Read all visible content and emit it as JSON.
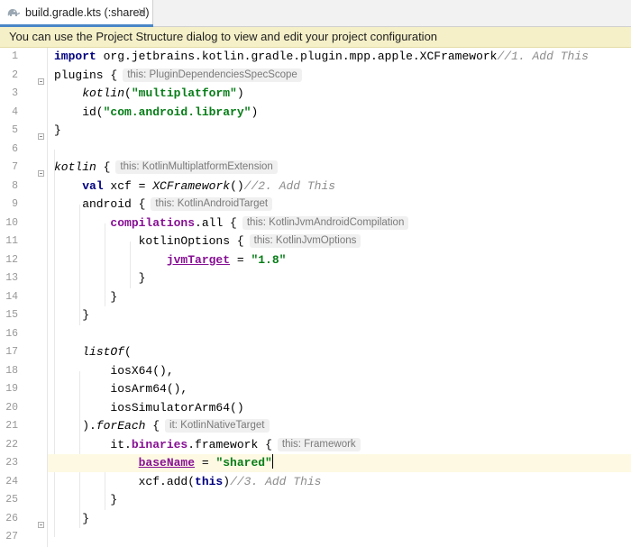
{
  "tab": {
    "title": "build.gradle.kts (:shared)",
    "close": "✕"
  },
  "notice": {
    "text": "You can use the Project Structure dialog to view and edit your project configuration"
  },
  "lines": [
    {
      "n": "1",
      "tokens": [
        {
          "t": "import",
          "c": "kw"
        },
        {
          "t": " org.jetbrains.kotlin.gradle.plugin.mpp.apple.XCFramework"
        },
        {
          "t": "//1. Add This",
          "c": "cmt"
        }
      ]
    },
    {
      "n": "2",
      "tokens": [
        {
          "t": "plugins {"
        }
      ],
      "hint": "this: PluginDependenciesSpecScope"
    },
    {
      "n": "3",
      "tokens": [
        {
          "t": "    "
        },
        {
          "t": "kotlin",
          "c": "ital"
        },
        {
          "t": "("
        },
        {
          "t": "\"multiplatform\"",
          "c": "str"
        },
        {
          "t": ")"
        }
      ]
    },
    {
      "n": "4",
      "tokens": [
        {
          "t": "    id("
        },
        {
          "t": "\"com.android.library\"",
          "c": "str"
        },
        {
          "t": ")"
        }
      ]
    },
    {
      "n": "5",
      "tokens": [
        {
          "t": "}"
        }
      ]
    },
    {
      "n": "6",
      "tokens": []
    },
    {
      "n": "7",
      "tokens": [
        {
          "t": "kotlin",
          "c": "ital"
        },
        {
          "t": " {"
        }
      ],
      "hint": "this: KotlinMultiplatformExtension"
    },
    {
      "n": "8",
      "tokens": [
        {
          "t": "    "
        },
        {
          "t": "val",
          "c": "kw"
        },
        {
          "t": " xcf = "
        },
        {
          "t": "XCFramework",
          "c": "ital"
        },
        {
          "t": "()"
        },
        {
          "t": "//2. Add This",
          "c": "cmt"
        }
      ]
    },
    {
      "n": "9",
      "tokens": [
        {
          "t": "    android {"
        }
      ],
      "hint": "this: KotlinAndroidTarget"
    },
    {
      "n": "10",
      "tokens": [
        {
          "t": "        "
        },
        {
          "t": "compilations",
          "c": "prop"
        },
        {
          "t": ".all {"
        }
      ],
      "hint": "this: KotlinJvmAndroidCompilation"
    },
    {
      "n": "11",
      "tokens": [
        {
          "t": "            kotlinOptions {"
        }
      ],
      "hint": "this: KotlinJvmOptions"
    },
    {
      "n": "12",
      "tokens": [
        {
          "t": "                "
        },
        {
          "t": "jvmTarget",
          "c": "prop ul"
        },
        {
          "t": " = "
        },
        {
          "t": "\"1.8\"",
          "c": "str"
        }
      ]
    },
    {
      "n": "13",
      "tokens": [
        {
          "t": "            }"
        }
      ]
    },
    {
      "n": "14",
      "tokens": [
        {
          "t": "        }"
        }
      ]
    },
    {
      "n": "15",
      "tokens": [
        {
          "t": "    }"
        }
      ]
    },
    {
      "n": "16",
      "tokens": []
    },
    {
      "n": "17",
      "tokens": [
        {
          "t": "    "
        },
        {
          "t": "listOf",
          "c": "ital"
        },
        {
          "t": "("
        }
      ]
    },
    {
      "n": "18",
      "tokens": [
        {
          "t": "        iosX64(),"
        }
      ]
    },
    {
      "n": "19",
      "tokens": [
        {
          "t": "        iosArm64(),"
        }
      ]
    },
    {
      "n": "20",
      "tokens": [
        {
          "t": "        iosSimulatorArm64()"
        }
      ]
    },
    {
      "n": "21",
      "tokens": [
        {
          "t": "    )."
        },
        {
          "t": "forEach",
          "c": "ital"
        },
        {
          "t": " {"
        }
      ],
      "hint": "it: KotlinNativeTarget"
    },
    {
      "n": "22",
      "tokens": [
        {
          "t": "        it."
        },
        {
          "t": "binaries",
          "c": "prop"
        },
        {
          "t": ".framework {"
        }
      ],
      "hint": "this: Framework"
    },
    {
      "n": "23",
      "tokens": [
        {
          "t": "            "
        },
        {
          "t": "baseName",
          "c": "prop ul"
        },
        {
          "t": " = "
        },
        {
          "t": "\"shared\"",
          "c": "str"
        }
      ],
      "current": true
    },
    {
      "n": "24",
      "tokens": [
        {
          "t": "            xcf.add("
        },
        {
          "t": "this",
          "c": "kw"
        },
        {
          "t": ")"
        },
        {
          "t": "//3. Add This",
          "c": "cmt"
        }
      ]
    },
    {
      "n": "25",
      "tokens": [
        {
          "t": "        }"
        }
      ]
    },
    {
      "n": "26",
      "tokens": [
        {
          "t": "    }"
        }
      ]
    },
    {
      "n": "27",
      "tokens": []
    }
  ],
  "colors": {
    "accent": "#4a86c7",
    "notice_bg": "#f5f0c8",
    "current_line": "#fdf9e3"
  }
}
